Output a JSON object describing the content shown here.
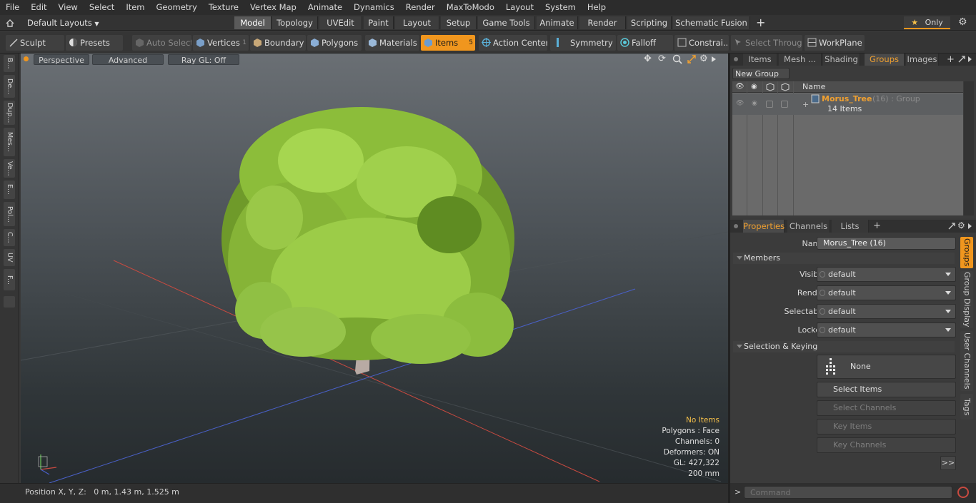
{
  "menu": [
    "File",
    "Edit",
    "View",
    "Select",
    "Item",
    "Geometry",
    "Texture",
    "Vertex Map",
    "Animate",
    "Dynamics",
    "Render",
    "MaxToModo",
    "Layout",
    "System",
    "Help"
  ],
  "layouts_label": "Default Layouts",
  "layout_tabs": [
    "Model",
    "Topology",
    "UVEdit",
    "Paint",
    "Layout",
    "Setup",
    "Game Tools",
    "Animate",
    "Render",
    "Scripting",
    "Schematic Fusion"
  ],
  "active_layout_tab": "Model",
  "add_tab": "+",
  "only_label": "Only",
  "toolbar": {
    "sculpt": "Sculpt",
    "presets": "Presets",
    "auto_select": "Auto Select",
    "vertices": "Vertices",
    "vertices_count": "1",
    "boundary": "Boundary",
    "polygons": "Polygons",
    "materials": "Materials",
    "items": "Items",
    "items_count": "5",
    "action_center": "Action Center",
    "symmetry": "Symmetry",
    "falloff": "Falloff",
    "constraints": "Constrai...",
    "select_through": "Select Through",
    "workplane": "WorkPlane"
  },
  "left_strip": [
    "B...",
    "De...",
    "Dup...",
    "Mes...",
    "Ve...",
    "E...",
    "Pol...",
    "C...",
    "UV",
    "F..."
  ],
  "viewport": {
    "view": "Perspective",
    "advanced": "Advanced",
    "raygl": "Ray GL: Off",
    "info": {
      "items": "No Items",
      "polygons": "Polygons : Face",
      "channels": "Channels: 0",
      "deformers": "Deformers: ON",
      "gl": "GL: 427,322",
      "scale": "200 mm"
    }
  },
  "status": "Position X, Y, Z:   0 m, 1.43 m, 1.525 m",
  "right_top_tabs": [
    "Items",
    "Mesh ...",
    "Shading",
    "Groups",
    "Images"
  ],
  "active_right_top_tab": "Groups",
  "new_group": "New Group",
  "groups_header": "Name",
  "group": {
    "name": "Morus_Tree",
    "meta": "(16) : Group",
    "count": "14 Items"
  },
  "right_bot_tabs": [
    "Properties",
    "Channels",
    "Lists"
  ],
  "properties": {
    "name_label": "Name",
    "name_value": "Morus_Tree (16)",
    "members": "Members",
    "visible_label": "Visible",
    "render_label": "Render",
    "selectable_label": "Selectable",
    "locked_label": "Locked",
    "default": "default",
    "sel_keying": "Selection & Keying",
    "none": "None",
    "select_items": "Select Items",
    "select_channels": "Select Channels",
    "key_items": "Key Items",
    "key_channels": "Key Channels",
    "more": ">>"
  },
  "side_vtabs": [
    "Groups",
    "Group Display",
    "User Channels",
    "Tags"
  ],
  "command_placeholder": "Command",
  "colors": {
    "accent": "#f0961e",
    "group_name": "#f0a030"
  }
}
